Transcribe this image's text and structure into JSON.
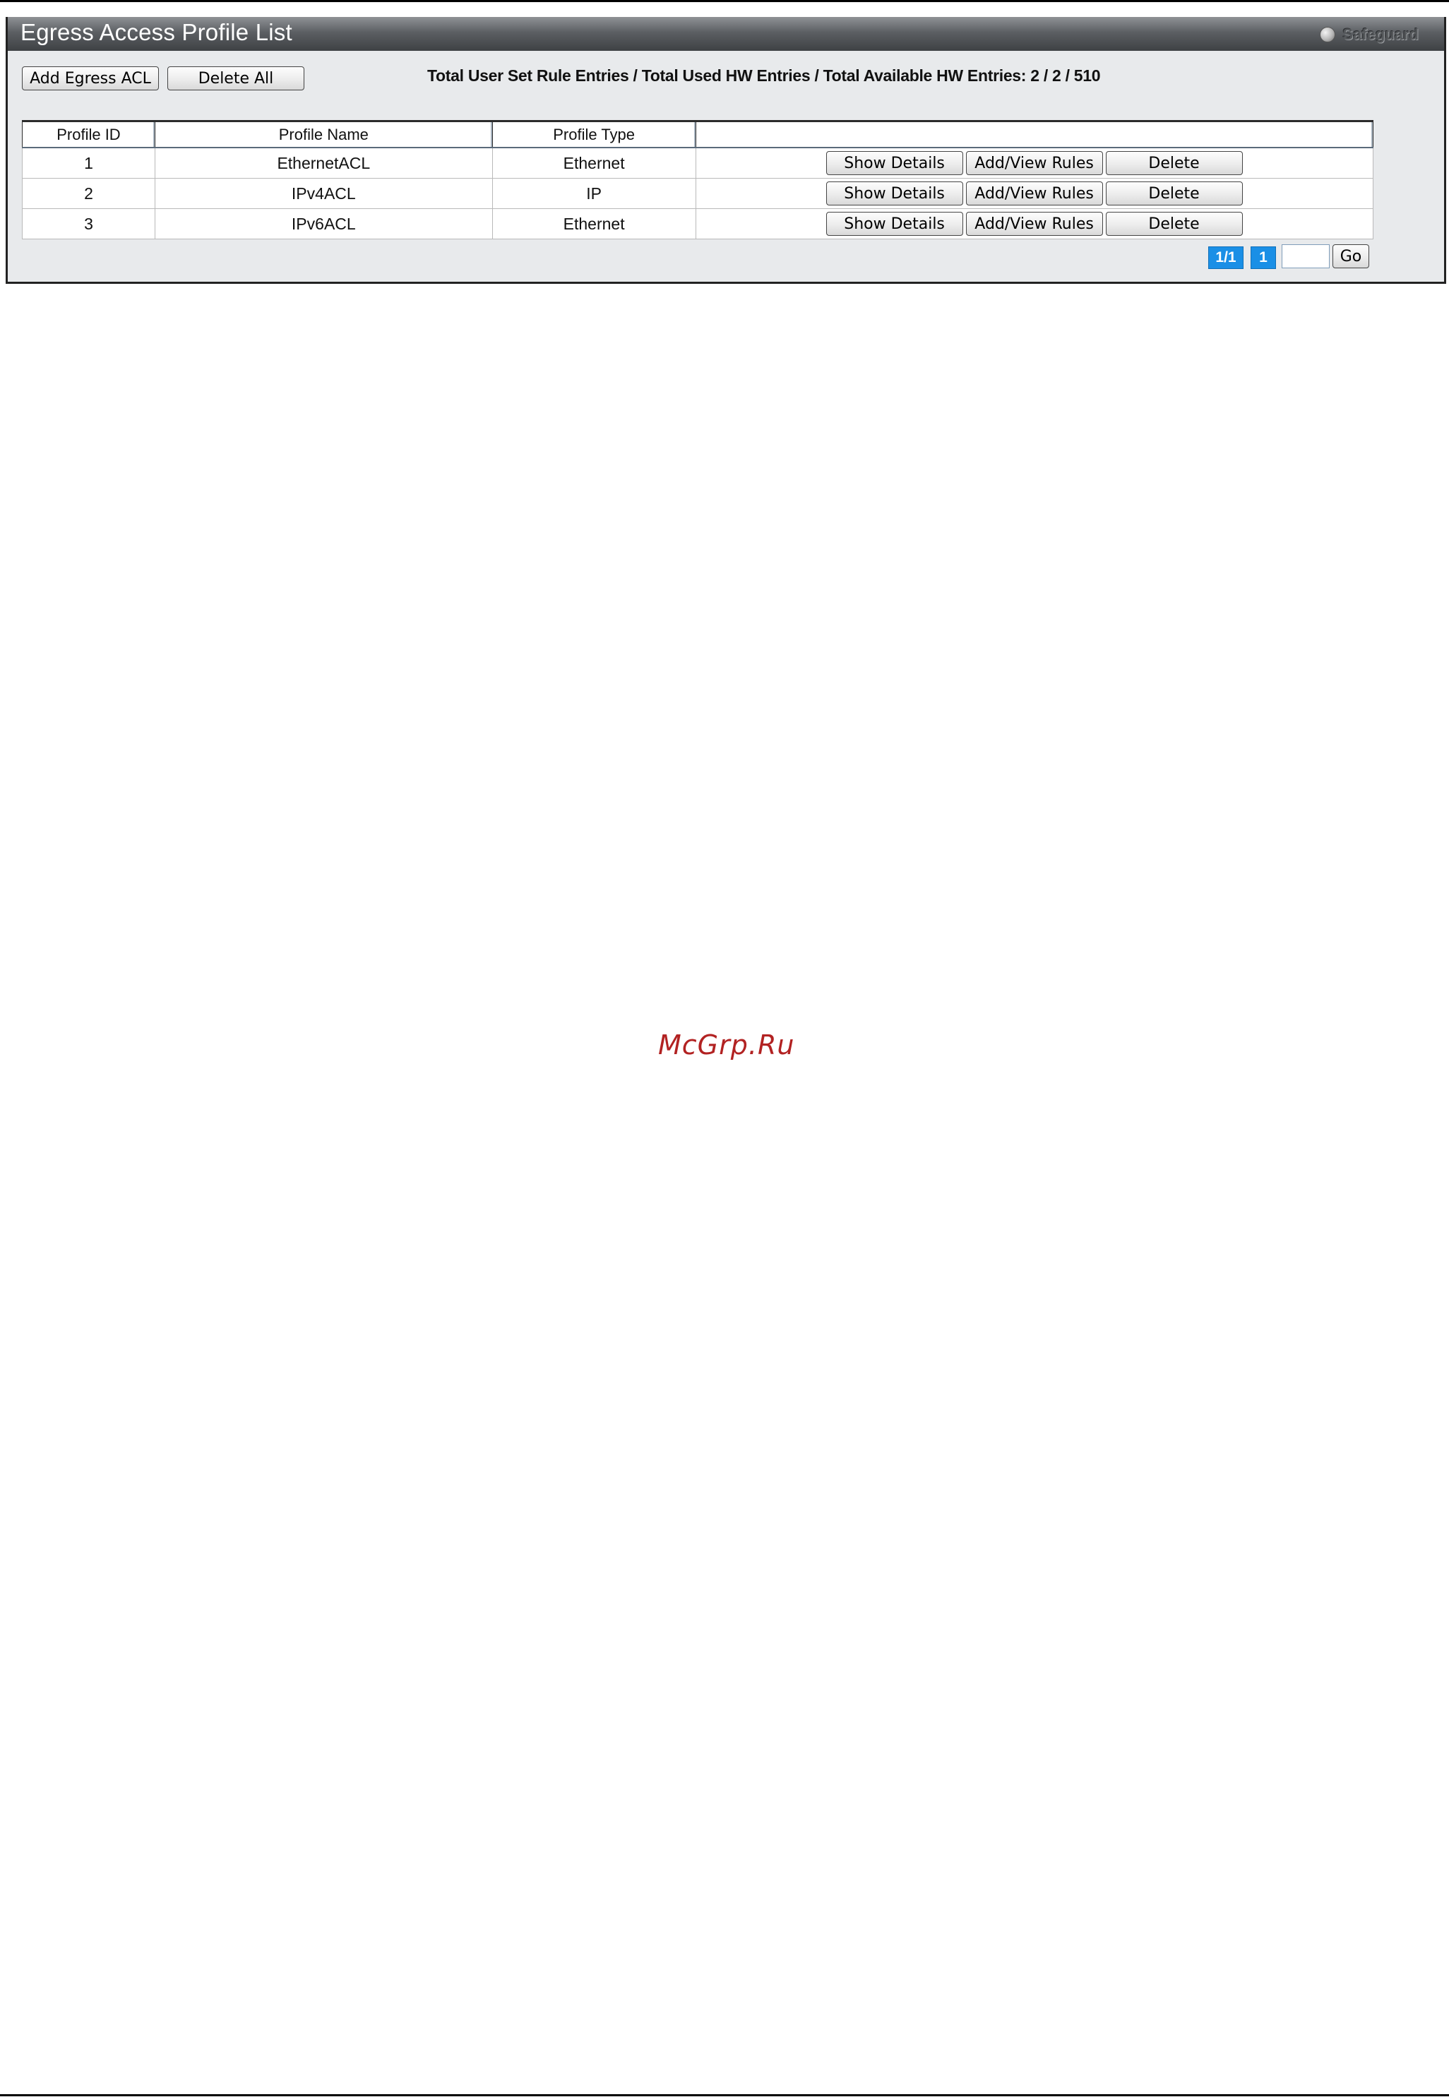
{
  "panel": {
    "title": "Egress Access Profile List",
    "safeguard_label": "Safeguard"
  },
  "toolbar": {
    "add_label": "Add Egress ACL",
    "delete_all_label": "Delete All",
    "summary": "Total User Set Rule Entries / Total Used HW Entries / Total Available HW Entries: 2 / 2 / 510"
  },
  "table": {
    "headers": [
      "Profile ID",
      "Profile Name",
      "Profile Type",
      ""
    ],
    "rows": [
      {
        "id": "1",
        "name": "EthernetACL",
        "type": "Ethernet"
      },
      {
        "id": "2",
        "name": "IPv4ACL",
        "type": "IP"
      },
      {
        "id": "3",
        "name": "IPv6ACL",
        "type": "Ethernet"
      }
    ],
    "row_buttons": {
      "show": "Show Details",
      "rules": "Add/View Rules",
      "delete": "Delete"
    }
  },
  "pager": {
    "page_info": "1/1",
    "current_page": "1",
    "page_input_value": "",
    "go_label": "Go"
  },
  "watermark": "McGrp.Ru",
  "colors": {
    "accent": "#1a8fe6",
    "watermark": "#b22222"
  }
}
